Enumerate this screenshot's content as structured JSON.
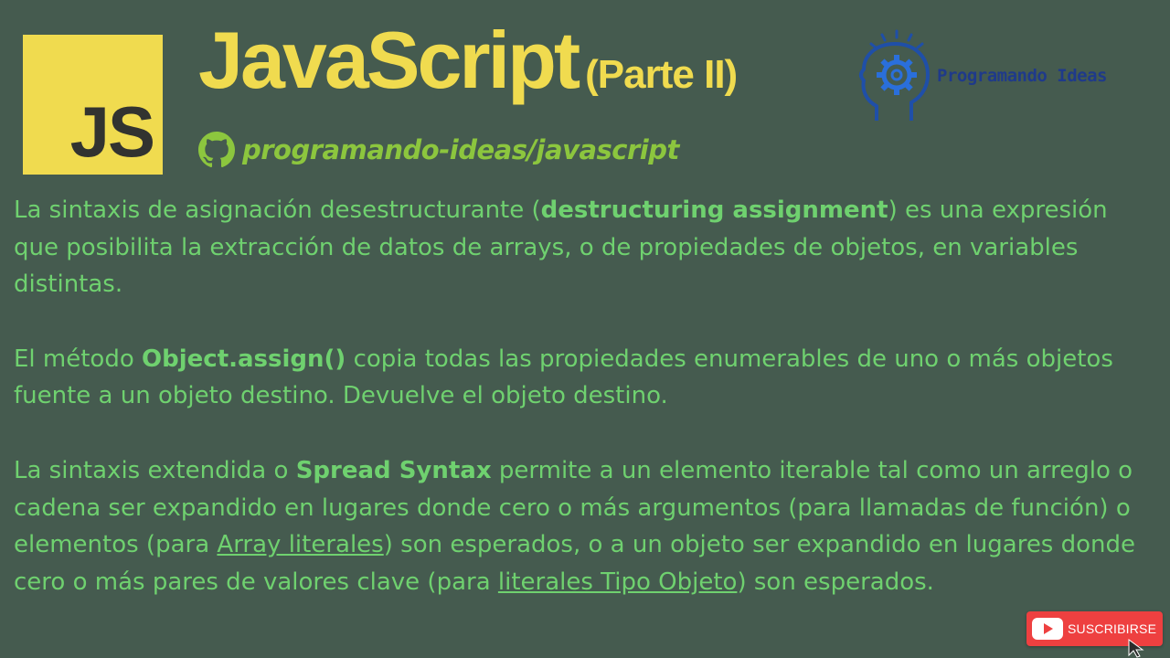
{
  "header": {
    "logo_text": "JS",
    "title_main": "JavaScript",
    "title_part": "(Parte II)",
    "repo_label": "programando-ideas/javascript",
    "brand_name": "Programando Ideas"
  },
  "content": {
    "p1": {
      "t1": "La sintaxis de asignación desestructurante  (",
      "b1": "destructuring assignment",
      "t2": ") es una expresión que posibilita la extracción de datos de arrays, o de propiedades de objetos, en variables distintas."
    },
    "p2": {
      "t1": "El método ",
      "b1": "Object.assign()",
      "t2": " copia todas las propiedades enumerables de uno o más objetos fuente a un objeto destino. Devuelve el objeto destino."
    },
    "p3": {
      "t1": "La sintaxis extendida o ",
      "b1": "Spread Syntax",
      "t2": " permite a un elemento iterable tal como un arreglo o cadena ser expandido en lugares donde cero o más argumentos (para llamadas de  función) o elementos (para ",
      "link1": "Array literales",
      "t3": ") son esperados, o a un objeto ser expandido en lugares donde cero o más pares de valores clave (para ",
      "link2": "literales Tipo Objeto",
      "t4": ") son esperados."
    }
  },
  "subscribe": {
    "label": "SUSCRIBIRSE"
  },
  "colors": {
    "background": "#455b4f",
    "js_yellow": "#f0db4f",
    "text_green": "#6fd16f",
    "repo_green": "#8cc63e",
    "brand_blue": "#1f3a8a",
    "subscribe_red": "#ee4040"
  },
  "icons": [
    "js-logo",
    "github-icon",
    "brain-gear-icon",
    "youtube-icon",
    "cursor-icon"
  ]
}
